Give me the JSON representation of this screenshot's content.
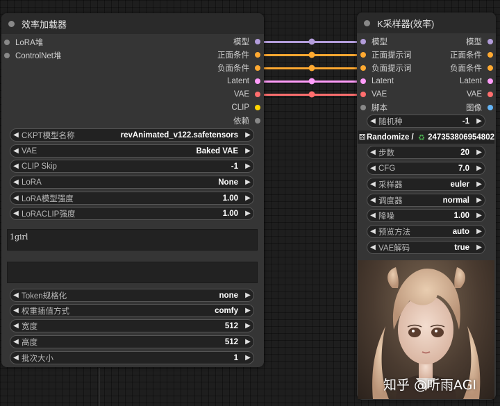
{
  "colors": {
    "model": "#b39ddb",
    "conditioning": "#ffa931",
    "latent": "#ff9cf9",
    "vae": "#ff6e6e",
    "clip": "#ffd500",
    "image": "#64b5f6",
    "generic": "#888888"
  },
  "loader": {
    "title": "效率加载器",
    "inputs": [
      "LoRA堆",
      "ControlNet堆"
    ],
    "outputs": [
      "模型",
      "正面条件",
      "负面条件",
      "Latent",
      "VAE",
      "CLIP",
      "依赖"
    ],
    "widgets": [
      {
        "label": "CKPT模型名称",
        "value": "revAnimated_v122.safetensors"
      },
      {
        "label": "VAE",
        "value": "Baked VAE"
      },
      {
        "label": "CLIP Skip",
        "value": "-1"
      },
      {
        "label": "LoRA",
        "value": "None"
      },
      {
        "label": "LoRA模型强度",
        "value": "1.00"
      },
      {
        "label": "LoRACLIP强度",
        "value": "1.00"
      }
    ],
    "positive_prompt": "1girl",
    "negative_prompt": "",
    "widgets2": [
      {
        "label": "Token规格化",
        "value": "none"
      },
      {
        "label": "权重插值方式",
        "value": "comfy"
      },
      {
        "label": "宽度",
        "value": "512"
      },
      {
        "label": "高度",
        "value": "512"
      },
      {
        "label": "批次大小",
        "value": "1"
      }
    ]
  },
  "sampler": {
    "title": "K采样器(效率)",
    "inputs": [
      "模型",
      "正面提示词",
      "负面提示词",
      "Latent",
      "VAE",
      "脚本"
    ],
    "outputs": [
      "模型",
      "正面条件",
      "负面条件",
      "Latent",
      "VAE",
      "图像"
    ],
    "seed": {
      "label": "随机种",
      "value": "-1"
    },
    "randomize": {
      "label": "Randomize /",
      "recycle_icon": "♻",
      "seed_value": "247353806954802"
    },
    "widgets": [
      {
        "label": "步数",
        "value": "20"
      },
      {
        "label": "CFG",
        "value": "7.0"
      },
      {
        "label": "采样器",
        "value": "euler"
      },
      {
        "label": "调度器",
        "value": "normal"
      },
      {
        "label": "降噪",
        "value": "1.00"
      },
      {
        "label": "预览方法",
        "value": "auto"
      },
      {
        "label": "VAE解码",
        "value": "true"
      }
    ]
  },
  "watermark": "知乎 @听雨AGI"
}
